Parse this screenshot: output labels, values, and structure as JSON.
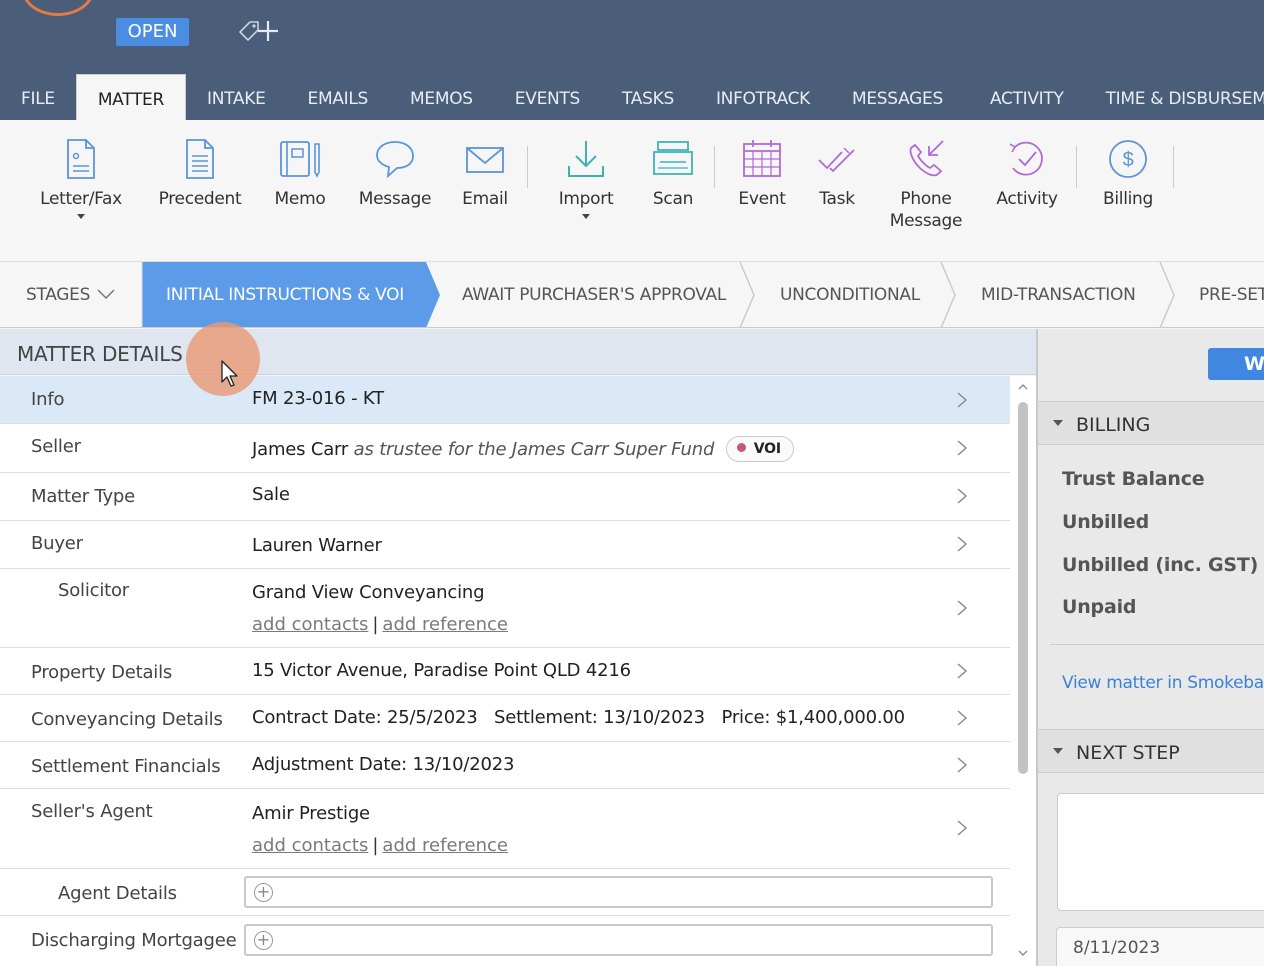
{
  "header": {
    "status_badge": "OPEN",
    "tabs": [
      {
        "label": "FILE",
        "active": false
      },
      {
        "label": "MATTER",
        "active": true
      },
      {
        "label": "INTAKE",
        "active": false
      },
      {
        "label": "EMAILS",
        "active": false
      },
      {
        "label": "MEMOS",
        "active": false
      },
      {
        "label": "EVENTS",
        "active": false
      },
      {
        "label": "TASKS",
        "active": false
      },
      {
        "label": "INFOTRACK",
        "active": false
      },
      {
        "label": "MESSAGES",
        "active": false
      },
      {
        "label": "ACTIVITY",
        "active": false
      },
      {
        "label": "TIME & DISBURSEME",
        "active": false
      }
    ]
  },
  "toolbar": {
    "items": [
      {
        "label": "Letter/Fax",
        "icon": "letter-icon"
      },
      {
        "label": "Precedent",
        "icon": "precedent-icon"
      },
      {
        "label": "Memo",
        "icon": "memo-icon"
      },
      {
        "label": "Message",
        "icon": "message-icon"
      },
      {
        "label": "Email",
        "icon": "email-icon"
      },
      {
        "label": "Import",
        "icon": "import-icon"
      },
      {
        "label": "Scan",
        "icon": "scan-icon"
      },
      {
        "label": "Event",
        "icon": "calendar-icon"
      },
      {
        "label": "Task",
        "icon": "task-check-icon"
      },
      {
        "label": "Phone",
        "label2": "Message",
        "icon": "phone-icon"
      },
      {
        "label": "Activity",
        "icon": "activity-icon"
      },
      {
        "label": "Billing",
        "icon": "dollar-icon"
      }
    ]
  },
  "stages": {
    "toggle_label": "STAGES",
    "items": [
      {
        "label": "INITIAL INSTRUCTIONS & VOI",
        "active": true
      },
      {
        "label": "AWAIT PURCHASER'S APPROVAL",
        "active": false
      },
      {
        "label": "UNCONDITIONAL",
        "active": false
      },
      {
        "label": "MID-TRANSACTION",
        "active": false
      },
      {
        "label": "PRE-SET",
        "active": false
      }
    ]
  },
  "matter_details": {
    "title": "MATTER DETAILS",
    "rows": {
      "info": {
        "label": "Info",
        "value": "FM 23-016 - KT"
      },
      "seller": {
        "label": "Seller",
        "name": "James Carr",
        "trustee": "as trustee for the James Carr Super Fund",
        "badge": "VOI"
      },
      "matter_type": {
        "label": "Matter Type",
        "value": "Sale"
      },
      "buyer": {
        "label": "Buyer",
        "value": "Lauren Warner"
      },
      "solicitor": {
        "label": "Solicitor",
        "value": "Grand View Conveyancing",
        "link1": "add contacts",
        "sep": "|",
        "link2": "add reference"
      },
      "property": {
        "label": "Property Details",
        "value": "15 Victor Avenue, Paradise Point QLD 4216"
      },
      "conveyancing": {
        "label": "Conveyancing Details",
        "value": "Contract Date: 25/5/2023   Settlement: 13/10/2023   Price: $1,400,000.00"
      },
      "settlement": {
        "label": "Settlement Financials",
        "value": "Adjustment Date: 13/10/2023"
      },
      "sellers_agent": {
        "label": "Seller's Agent",
        "value": "Amir Prestige",
        "link1": "add contacts",
        "sep": "|",
        "link2": "add reference"
      },
      "agent_details": {
        "label": "Agent Details"
      },
      "discharging": {
        "label": "Discharging Mortgagee"
      }
    }
  },
  "right_panel": {
    "button_label": "WID",
    "billing_title": "BILLING",
    "billing_items": [
      "Trust Balance",
      "Unbilled",
      "Unbilled (inc. GST)",
      "Unpaid"
    ],
    "link": "View matter in Smokeball",
    "next_step_title": "NEXT STEP",
    "date_value": "8/11/2023"
  },
  "colors": {
    "header_bg": "#4a5d79",
    "accent_blue": "#4a8de2",
    "stage_active": "#5b9be8",
    "icon_blue": "#5a95d8",
    "icon_teal": "#3cb3b3",
    "icon_purple": "#b06ad6",
    "cursor_highlight": "#e99873"
  }
}
